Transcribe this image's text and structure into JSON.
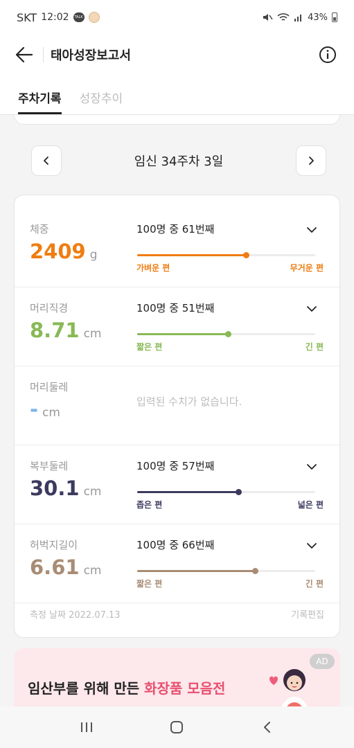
{
  "status": {
    "carrier": "SKT",
    "time": "12:02",
    "battery": "43%"
  },
  "appbar": {
    "title": "태아성장보고서"
  },
  "tabs": [
    {
      "label": "주차기록",
      "active": true
    },
    {
      "label": "성장추이",
      "active": false
    }
  ],
  "week": {
    "label": "임신 34주차 3일"
  },
  "metrics": [
    {
      "label": "체중",
      "value": "2409",
      "unit": "g",
      "rank": "100명 중 61번째",
      "low_label": "가벼운 편",
      "high_label": "무거운 편",
      "percentile": 0.61,
      "color": "#ef7d12"
    },
    {
      "label": "머리직경",
      "value": "8.71",
      "unit": "cm",
      "rank": "100명 중 51번째",
      "low_label": "짧은 편",
      "high_label": "긴 편",
      "percentile": 0.51,
      "color": "#88b955"
    },
    {
      "label": "머리둘레",
      "value": "-",
      "unit": "cm",
      "empty_message": "입력된 수치가 없습니다.",
      "color": "#7ab4e8"
    },
    {
      "label": "복부둘레",
      "value": "30.1",
      "unit": "cm",
      "rank": "100명 중 57번째",
      "low_label": "좁은 편",
      "high_label": "넓은 편",
      "percentile": 0.57,
      "color": "#3b3a5e"
    },
    {
      "label": "허벅지길이",
      "value": "6.61",
      "unit": "cm",
      "rank": "100명 중 66번째",
      "low_label": "짧은 편",
      "high_label": "긴 편",
      "percentile": 0.66,
      "color": "#a88c74"
    }
  ],
  "footer": {
    "date": "측정 날짜 2022.07.13",
    "edit": "기록편집"
  },
  "ad": {
    "text_plain": "임산부를 위해 만든 ",
    "text_accent": "화장품 모음전",
    "badge": "AD"
  }
}
